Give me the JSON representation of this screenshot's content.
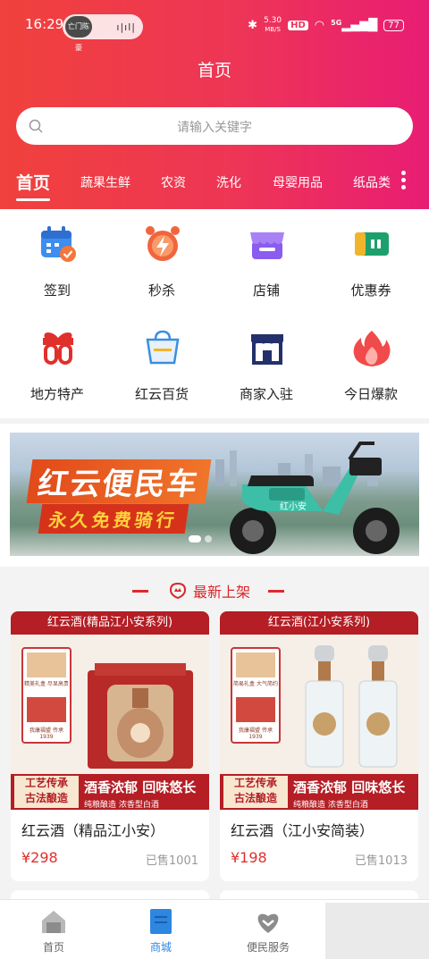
{
  "status_bar": {
    "time": "16:29",
    "avatar_text": "亡门陈豪",
    "speed_top": "5.30",
    "speed_unit": "MB/S",
    "hd": "HD",
    "network": "5G",
    "battery": "77"
  },
  "header": {
    "title": "首页",
    "search_placeholder": "请输入关键字"
  },
  "category_tabs": [
    {
      "label": "首页",
      "active": true
    },
    {
      "label": "蔬果生鲜"
    },
    {
      "label": "农资"
    },
    {
      "label": "洗化"
    },
    {
      "label": "母婴用品"
    },
    {
      "label": "纸品类"
    }
  ],
  "quick_grid": [
    {
      "label": "签到",
      "icon": "calendar-check-icon"
    },
    {
      "label": "秒杀",
      "icon": "alarm-flash-icon"
    },
    {
      "label": "店铺",
      "icon": "store-icon"
    },
    {
      "label": "优惠券",
      "icon": "coupon-icon"
    },
    {
      "label": "地方特产",
      "icon": "gift-box-icon"
    },
    {
      "label": "红云百货",
      "icon": "shopping-basket-icon"
    },
    {
      "label": "商家入驻",
      "icon": "shopfront-icon"
    },
    {
      "label": "今日爆款",
      "icon": "fire-icon"
    }
  ],
  "banner": {
    "title": "红云便民车",
    "subtitle": "永久免费骑行",
    "scooter_brand": "红小安"
  },
  "section": {
    "title": "最新上架"
  },
  "products": [
    {
      "banner_title": "红云酒(精品江小安系列)",
      "tag_line1": "工艺传承",
      "tag_line2": "古法酿造",
      "slogan": "酒香浓郁 回味悠长",
      "slogan_small": "纯粮酿造 浓香型白酒",
      "side_text_1": "精美礼盒 尽显高贵",
      "side_text_2": "我康福盟 传承1939",
      "name": "红云酒（精品江小安）",
      "price": "¥298",
      "sold": "已售1001"
    },
    {
      "banner_title": "红云酒(江小安系列)",
      "tag_line1": "工艺传承",
      "tag_line2": "古法酿造",
      "slogan": "酒香浓郁 回味悠长",
      "slogan_small": "纯粮酿造 浓香型白酒",
      "side_text_1": "简易礼盒 大气简约",
      "side_text_2": "我康福盟 传承1939",
      "name": "红云酒（江小安简装）",
      "price": "¥198",
      "sold": "已售1013"
    }
  ],
  "tab_bar": [
    {
      "label": "首页",
      "icon": "home-icon"
    },
    {
      "label": "商城",
      "icon": "mall-icon",
      "active": true
    },
    {
      "label": "便民服务",
      "icon": "heart-service-icon"
    },
    {
      "label": "",
      "icon": "profile-icon"
    }
  ],
  "colors": {
    "header_start": "#f0413c",
    "header_end": "#e81d74",
    "accent_red": "#e0302b",
    "tab_active": "#2d86e0"
  }
}
